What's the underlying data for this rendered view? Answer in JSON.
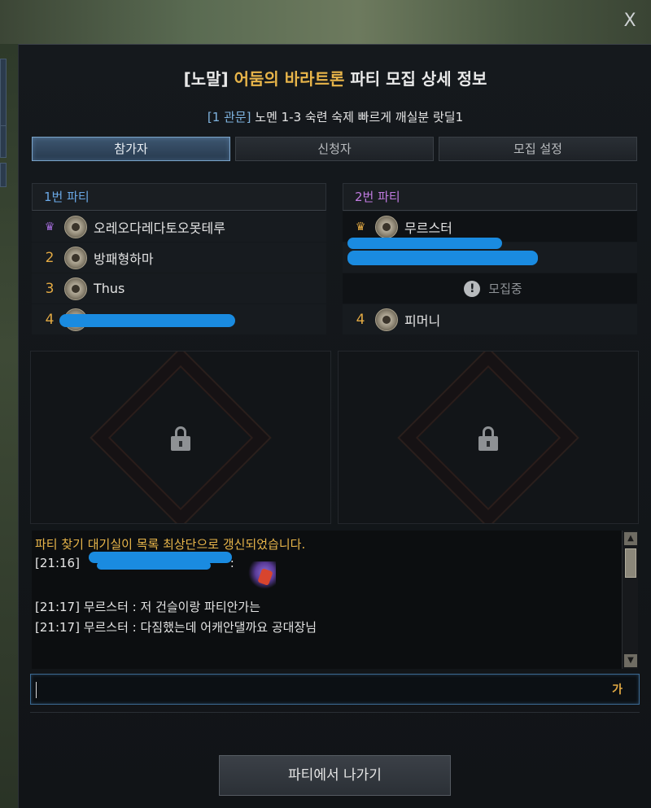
{
  "window": {
    "close_label": "X",
    "title_prefix": "[노말] ",
    "title_raid": "어둠의 바라트론",
    "title_suffix": " 파티 모집 상세 정보",
    "subtitle_tag": "[1 관문]",
    "subtitle_text": " 노멘 1-3 숙련 숙제 빠르게 깨실분 랏딜1"
  },
  "tabs": [
    {
      "label": "참가자",
      "active": true
    },
    {
      "label": "신청자",
      "active": false
    },
    {
      "label": "모집 설정",
      "active": false
    }
  ],
  "party1": {
    "header": "1번 파티",
    "members": [
      {
        "slot": "1",
        "leader": true,
        "name": "오레오다레다토오못테루"
      },
      {
        "slot": "2",
        "leader": false,
        "name": "방패형하마"
      },
      {
        "slot": "3",
        "leader": false,
        "name": "Thus"
      },
      {
        "slot": "4",
        "leader": false,
        "name": ""
      }
    ]
  },
  "party2": {
    "header": "2번 파티",
    "members": [
      {
        "slot": "1",
        "leader": true,
        "name": "무르스터"
      },
      {
        "slot": "2",
        "leader": false,
        "name": ""
      },
      {
        "slot": "3",
        "recruiting": true,
        "name": "모집중"
      },
      {
        "slot": "4",
        "leader": false,
        "name": "피머니"
      }
    ]
  },
  "chat": {
    "system_message": "파티 찾기 대기실이 목록 최상단으로 갱신되었습니다.",
    "lines": [
      {
        "time": "[21:16]",
        "text": " :"
      },
      {
        "time": "[21:17]",
        "text": " 무르스터 : 저 건슬이랑 파티안가는"
      },
      {
        "time": "[21:17]",
        "text": " 무르스터 : 다짐했는데 어캐안댈까요 공대장님"
      }
    ],
    "input_value": "",
    "ime_indicator": "가"
  },
  "leave_button": "파티에서 나가기",
  "colors": {
    "gold": "#e8b54a",
    "party1": "#6aa8e6",
    "party2": "#c07be0",
    "active_tab": "#3d5670"
  }
}
